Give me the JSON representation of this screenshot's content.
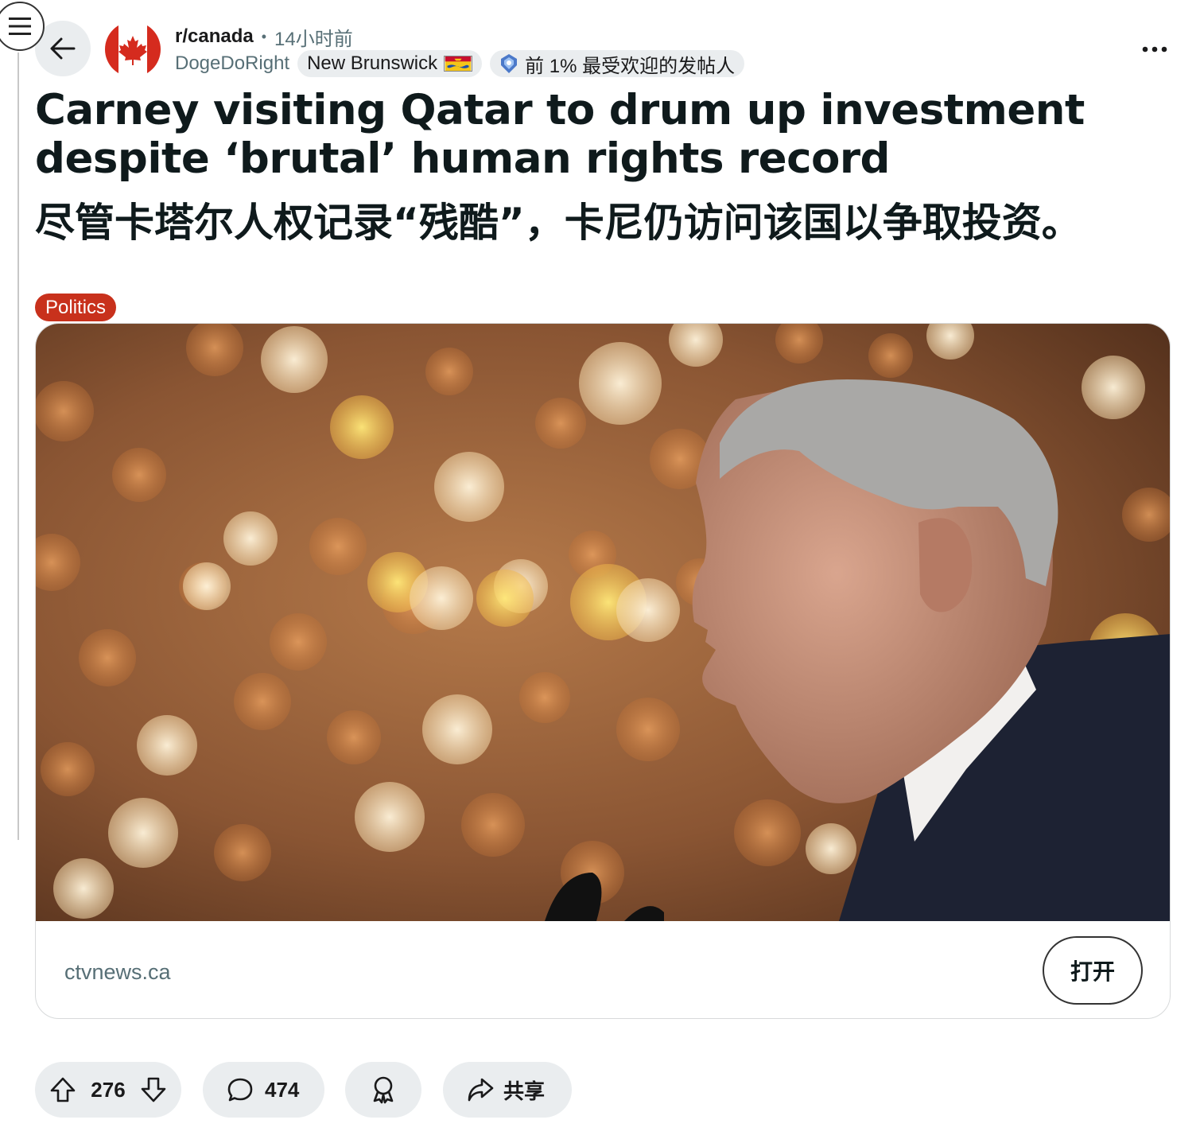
{
  "post": {
    "subreddit": "r/canada",
    "time_ago": "14小时前",
    "username": "DogeDoRight",
    "user_flair": "New Brunswick",
    "achievement_badge": "前 1% 最受欢迎的发帖人",
    "title_en": "Carney visiting Qatar to drum up investment despite ‘brutal’ human rights record",
    "title_zh": "尽管卡塔尔人权记录“残酷”，卡尼仍访问该国以争取投资。",
    "post_flair": "Politics",
    "link_domain": "ctvnews.ca",
    "open_label": "打开",
    "upvotes": "276",
    "comments": "474",
    "share_label": "共享"
  },
  "icons": [
    "menu-icon",
    "back-arrow-icon",
    "canada-flag-icon",
    "new-brunswick-flag-icon",
    "top-poster-badge-icon",
    "more-options-icon",
    "upvote-icon",
    "downvote-icon",
    "comment-icon",
    "award-icon",
    "share-icon"
  ],
  "colors": {
    "flair_politics": "#c8311c",
    "chip_background": "#eaedef",
    "muted_text": "#576f76"
  }
}
